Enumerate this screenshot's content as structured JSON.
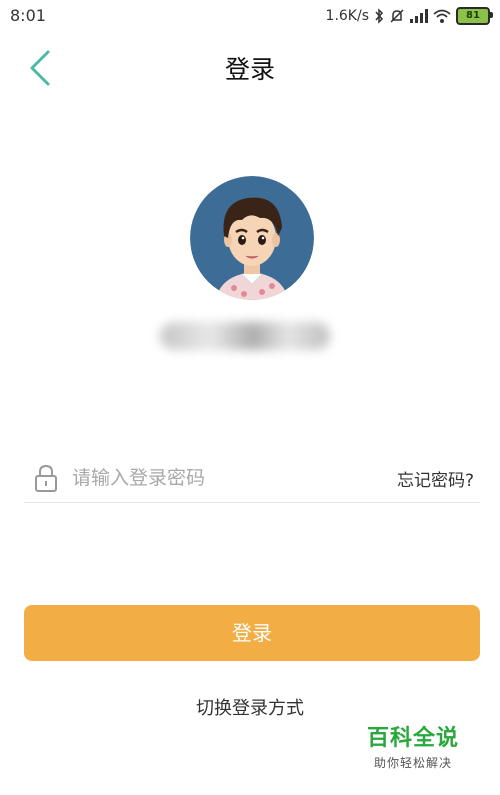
{
  "status_bar": {
    "time": "8:01",
    "net_speed": "1.6K/s",
    "battery": "81",
    "icons": [
      "bluetooth-icon",
      "mute-icon",
      "signal-icon",
      "wifi-icon",
      "battery-icon"
    ]
  },
  "header": {
    "title": "登录",
    "back_icon": "chevron-left-icon"
  },
  "account": {
    "avatar_icon": "cartoon-boy-avatar"
  },
  "password": {
    "placeholder": "请输入登录密码",
    "value": "",
    "lock_icon": "lock-icon"
  },
  "forgot_label": "忘记密码?",
  "login_label": "登录",
  "switch_label": "切换登录方式",
  "watermark": {
    "title": "百科全说",
    "subtitle": "助你轻松解决"
  },
  "colors": {
    "accent": "#4bb8a8",
    "button": "#f2ae44",
    "watermark": "#29a83c"
  }
}
